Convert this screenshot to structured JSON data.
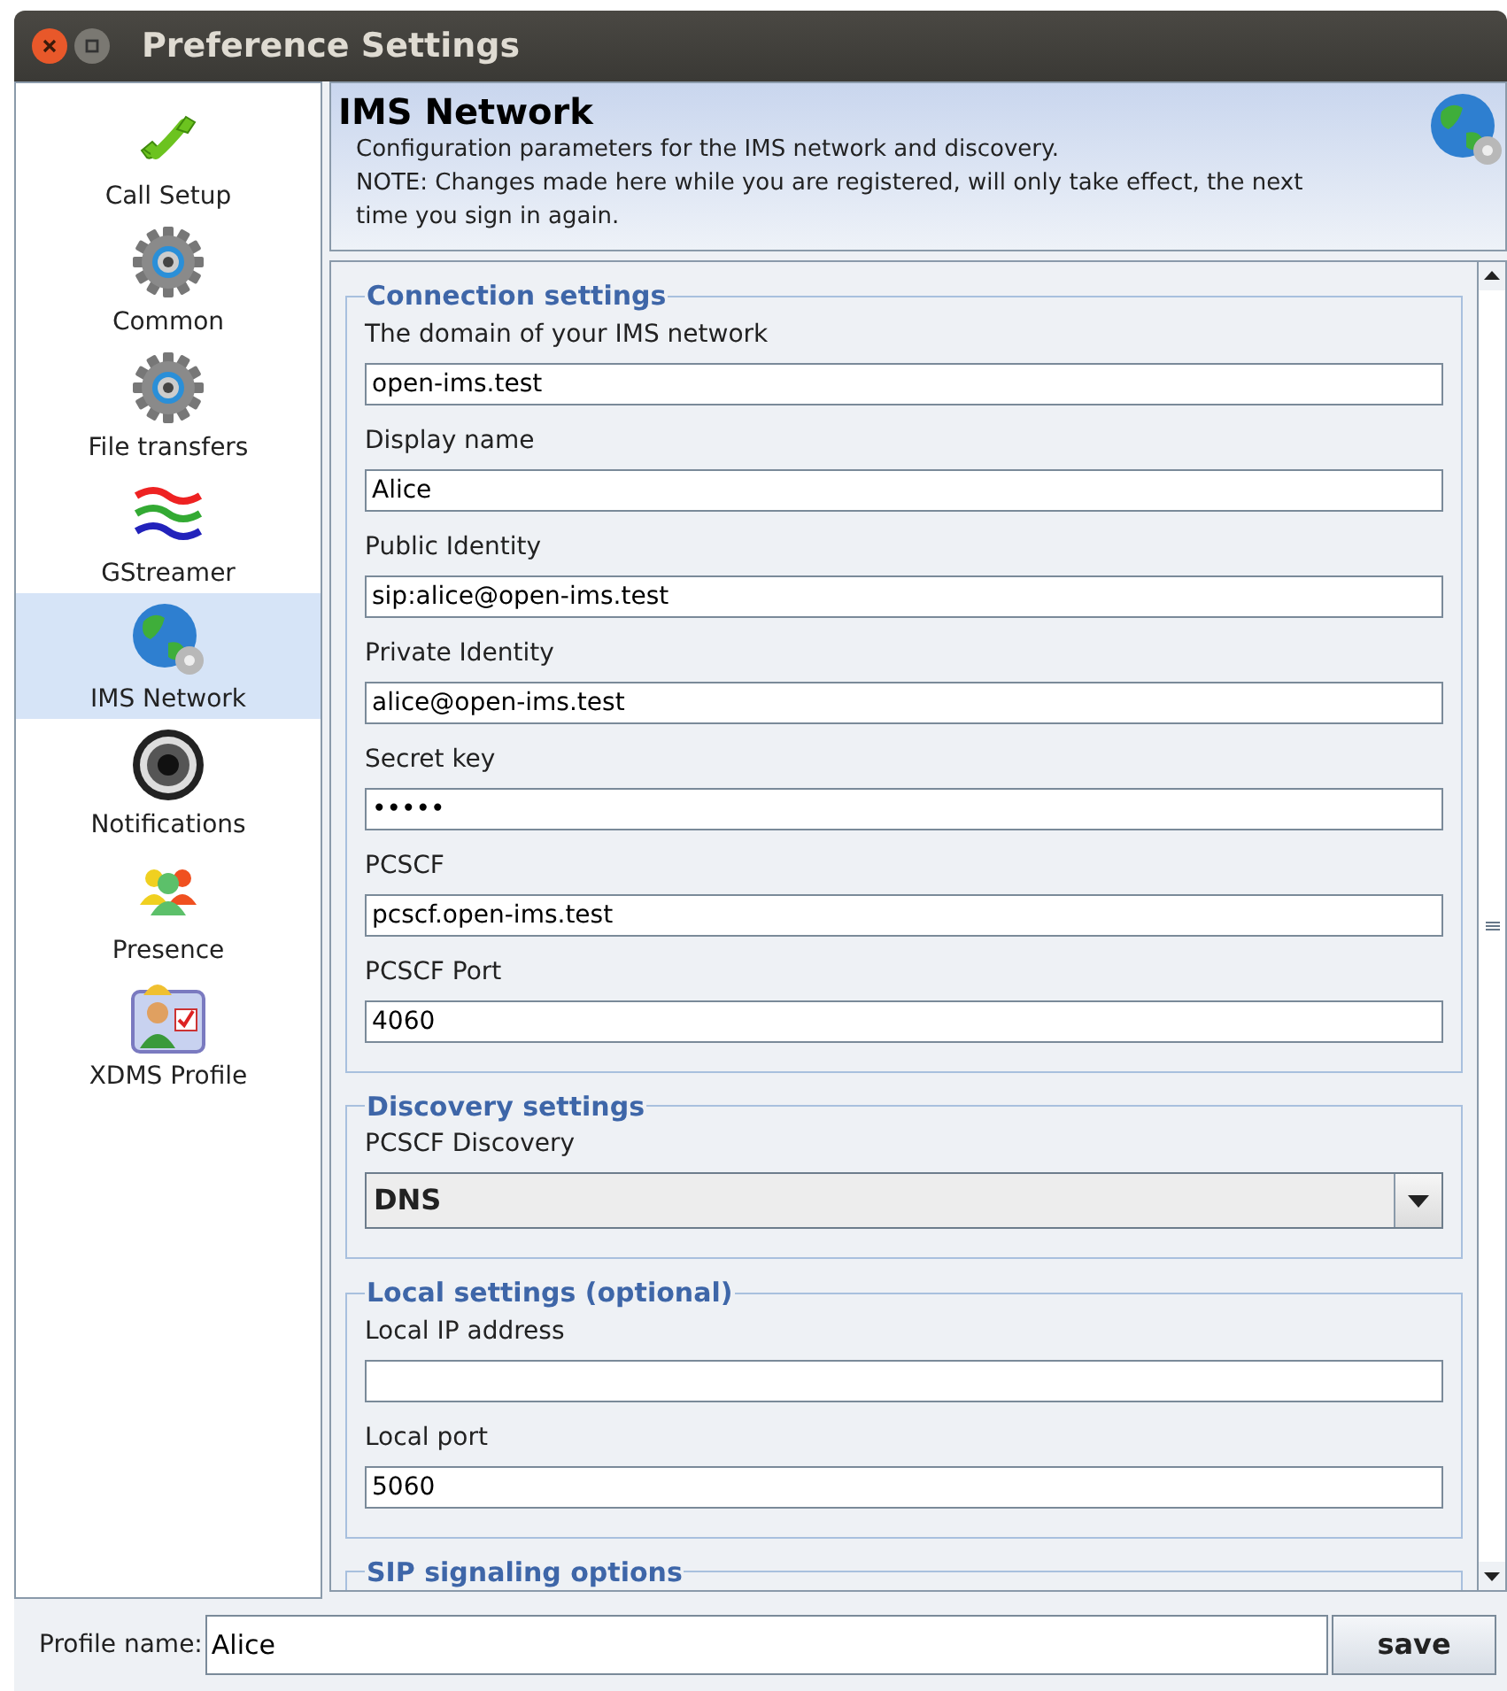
{
  "window": {
    "title": "Preference Settings"
  },
  "sidebar": {
    "items": [
      {
        "label": "Call Setup",
        "kind": "phone",
        "selected": false
      },
      {
        "label": "Common",
        "kind": "gear",
        "selected": false
      },
      {
        "label": "File transfers",
        "kind": "gear",
        "selected": false
      },
      {
        "label": "GStreamer",
        "kind": "waves",
        "selected": false
      },
      {
        "label": "IMS Network",
        "kind": "globe",
        "selected": true
      },
      {
        "label": "Notifications",
        "kind": "speaker",
        "selected": false
      },
      {
        "label": "Presence",
        "kind": "people",
        "selected": false
      },
      {
        "label": "XDMS Profile",
        "kind": "profile",
        "selected": false
      }
    ]
  },
  "header": {
    "title": "IMS Network",
    "description": "Configuration parameters for the IMS network and discovery.\nNOTE: Changes made here while you are registered, will only take effect, the next\ntime you sign in again."
  },
  "sections": [
    {
      "title": "Connection settings",
      "fields": [
        {
          "label": "The domain of your IMS network",
          "kind": "text",
          "value": "open-ims.test"
        },
        {
          "label": "Display name",
          "kind": "text",
          "value": "Alice"
        },
        {
          "label": "Public Identity",
          "kind": "text",
          "value": "sip:alice@open-ims.test"
        },
        {
          "label": "Private Identity",
          "kind": "text",
          "value": "alice@open-ims.test"
        },
        {
          "label": "Secret key",
          "kind": "text",
          "value": "•••••"
        },
        {
          "label": "PCSCF",
          "kind": "text",
          "value": "pcscf.open-ims.test"
        },
        {
          "label": "PCSCF Port",
          "kind": "text",
          "value": "4060"
        }
      ]
    },
    {
      "title": "Discovery settings",
      "fields": [
        {
          "label": "PCSCF Discovery",
          "kind": "select",
          "value": "DNS"
        }
      ]
    },
    {
      "title": "Local settings (optional)",
      "fields": [
        {
          "label": "Local IP address",
          "kind": "text"
        },
        {
          "label": "Local port",
          "kind": "text",
          "value": "5060"
        }
      ]
    },
    {
      "title": "SIP signaling options"
    }
  ],
  "footer": {
    "label": "Profile name:",
    "value": "Alice",
    "button": "save"
  }
}
